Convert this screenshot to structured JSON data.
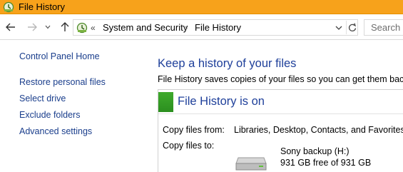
{
  "window": {
    "title": "File History"
  },
  "nav": {
    "breadcrumb_overflow": "«",
    "crumbs": [
      "System and Security",
      "File History"
    ],
    "separator": "›",
    "search_placeholder": "Search C"
  },
  "sidebar": {
    "items": [
      {
        "label": "Control Panel Home"
      },
      {
        "label": "Restore personal files"
      },
      {
        "label": "Select drive"
      },
      {
        "label": "Exclude folders"
      },
      {
        "label": "Advanced settings"
      }
    ]
  },
  "main": {
    "heading": "Keep a history of your files",
    "description": "File History saves copies of your files so you can get them back if",
    "status": "File History is on",
    "status_color": "#3faa2c",
    "copy_from_label": "Copy files from:",
    "copy_from_value": "Libraries, Desktop, Contacts, and Favorites",
    "copy_to_label": "Copy files to:",
    "drive_name": "Sony backup (H:)",
    "drive_free": "931 GB free of 931 GB"
  },
  "colors": {
    "titlebar": "#f7a21b",
    "link": "#1a3e8c",
    "heading": "#1e3f9a"
  }
}
